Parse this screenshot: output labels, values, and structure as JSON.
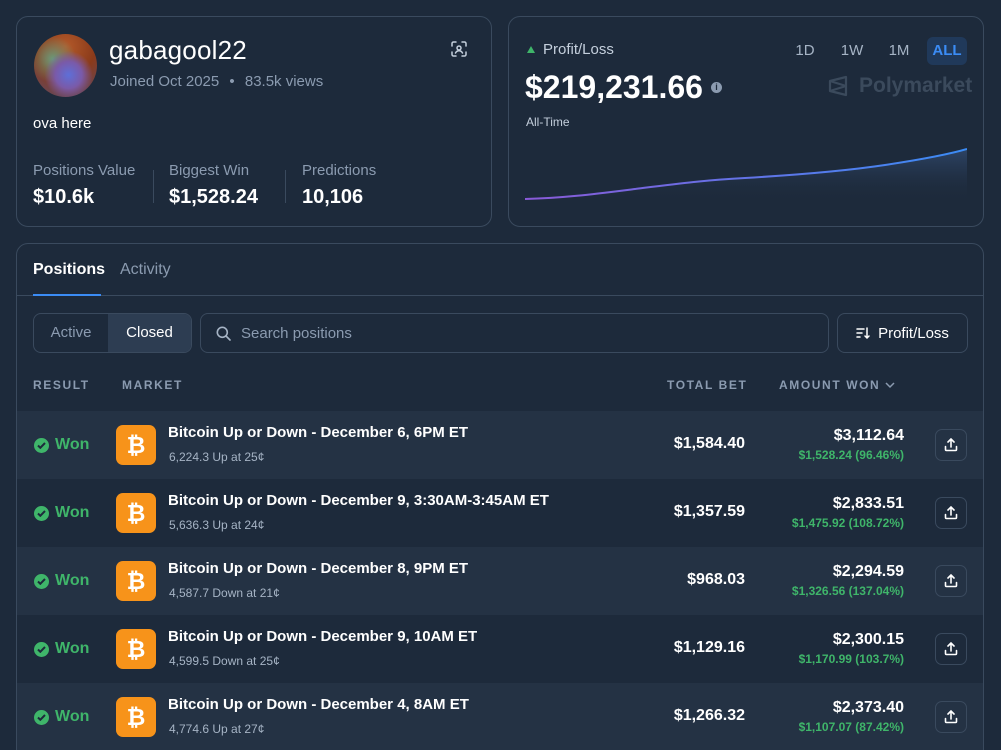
{
  "profile": {
    "username": "gabagool22",
    "joined": "Joined Oct 2025",
    "separator": "•",
    "views": "83.5k views",
    "bio": "ova here",
    "stats": [
      {
        "label": "Positions Value",
        "value": "$10.6k"
      },
      {
        "label": "Biggest Win",
        "value": "$1,528.24"
      },
      {
        "label": "Predictions",
        "value": "10,106"
      }
    ]
  },
  "profit_loss": {
    "label": "Profit/Loss",
    "value": "$219,231.66",
    "period": "All-Time",
    "ranges": [
      "1D",
      "1W",
      "1M",
      "ALL"
    ],
    "active_range": "ALL",
    "brand": "Polymarket",
    "colors": {
      "up": "#3fb56a",
      "accent": "#3b8cf5"
    }
  },
  "tabs": {
    "positions": "Positions",
    "activity": "Activity"
  },
  "filters": {
    "active": "Active",
    "closed": "Closed",
    "search_placeholder": "Search positions",
    "sort_label": "Profit/Loss"
  },
  "table": {
    "headers": {
      "result": "RESULT",
      "market": "MARKET",
      "total_bet": "TOTAL BET",
      "amount_won": "AMOUNT WON"
    },
    "rows": [
      {
        "result": "Won",
        "title": "Bitcoin Up or Down - December 6, 6PM ET",
        "sub": "6,224.3 Up at 25¢",
        "bet": "$1,584.40",
        "won": "$3,112.64",
        "gain": "$1,528.24 (96.46%)"
      },
      {
        "result": "Won",
        "title": "Bitcoin Up or Down - December 9, 3:30AM-3:45AM ET",
        "sub": "5,636.3 Up at 24¢",
        "bet": "$1,357.59",
        "won": "$2,833.51",
        "gain": "$1,475.92 (108.72%)"
      },
      {
        "result": "Won",
        "title": "Bitcoin Up or Down - December 8, 9PM ET",
        "sub": "4,587.7 Down at 21¢",
        "bet": "$968.03",
        "won": "$2,294.59",
        "gain": "$1,326.56 (137.04%)"
      },
      {
        "result": "Won",
        "title": "Bitcoin Up or Down - December 9, 10AM ET",
        "sub": "4,599.5 Down at 25¢",
        "bet": "$1,129.16",
        "won": "$2,300.15",
        "gain": "$1,170.99 (103.7%)"
      },
      {
        "result": "Won",
        "title": "Bitcoin Up or Down - December 4, 8AM ET",
        "sub": "4,774.6 Up at 27¢",
        "bet": "$1,266.32",
        "won": "$2,373.40",
        "gain": "$1,107.07 (87.42%)"
      }
    ]
  },
  "icons": {
    "btc": "bitcoin-icon",
    "btc_glyph": "₿",
    "check": "check-circle-icon",
    "share": "share-icon",
    "search": "search-icon",
    "sort": "sort-icon",
    "scan": "scan-qr-icon",
    "info": "info-icon",
    "info_glyph": "i"
  }
}
